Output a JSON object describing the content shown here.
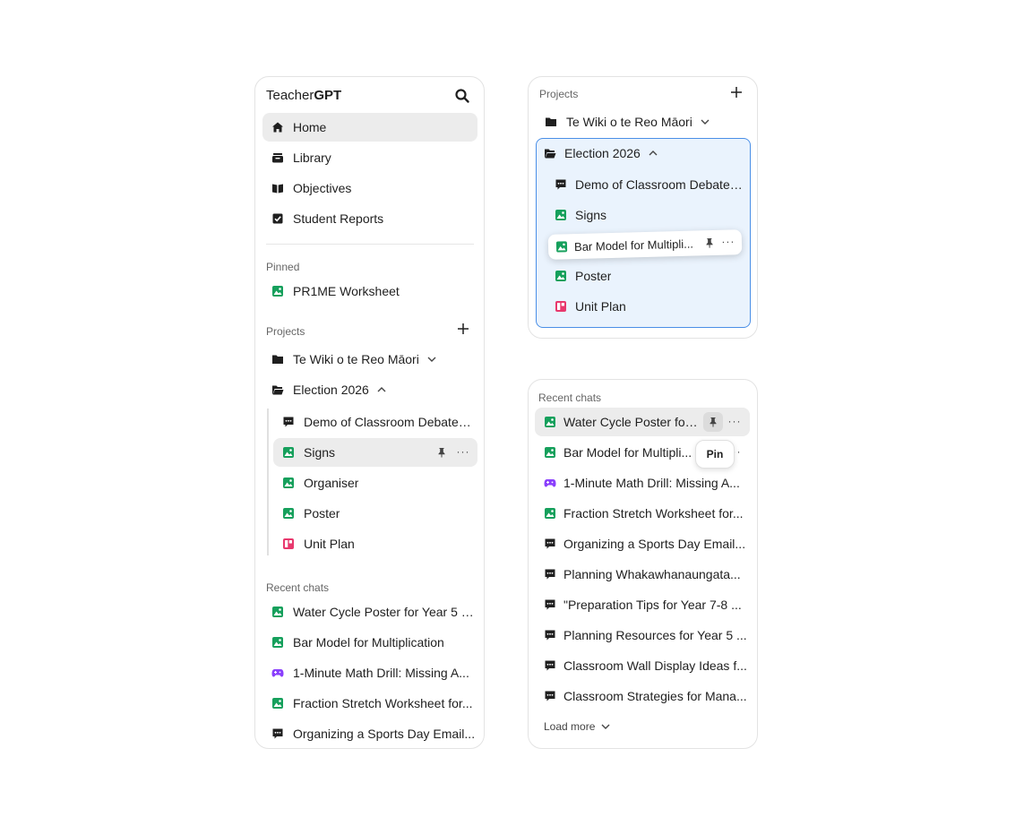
{
  "colors": {
    "image_icon": "#16a05c",
    "chat_icon": "#1f1f1f",
    "game_icon": "#8a3ffc",
    "plan_icon": "#e8386d",
    "highlight_border": "#4a8fe7",
    "highlight_bg": "#eaf3fd"
  },
  "sidebar": {
    "brand_prefix": "Teacher",
    "brand_suffix": "GPT",
    "nav": [
      {
        "label": "Home",
        "icon": "home-icon"
      },
      {
        "label": "Library",
        "icon": "library-icon"
      },
      {
        "label": "Objectives",
        "icon": "book-icon"
      },
      {
        "label": "Student Reports",
        "icon": "checkbox-icon"
      }
    ],
    "pinned_label": "Pinned",
    "pinned": [
      {
        "label": "PR1ME Worksheet",
        "icon": "image-icon"
      }
    ],
    "projects_label": "Projects",
    "projects": [
      {
        "label": "Te Wiki o te Reo Māori",
        "icon": "folder-icon"
      },
      {
        "label": "Election 2026",
        "icon": "folder-open-icon"
      }
    ],
    "election_items": [
      {
        "label": "Demo of Classroom Debate ...",
        "icon": "chat-icon"
      },
      {
        "label": "Signs",
        "icon": "image-icon"
      },
      {
        "label": "Organiser",
        "icon": "image-icon"
      },
      {
        "label": "Poster",
        "icon": "image-icon"
      },
      {
        "label": "Unit Plan",
        "icon": "plan-icon"
      }
    ],
    "recent_label": "Recent chats",
    "recent": [
      {
        "label": "Water Cycle Poster for Year 5 S...",
        "icon": "image-icon"
      },
      {
        "label": "Bar Model for Multiplication",
        "icon": "image-icon"
      },
      {
        "label": "1-Minute Math Drill: Missing A...",
        "icon": "game-icon"
      },
      {
        "label": "Fraction Stretch Worksheet for...",
        "icon": "image-icon"
      },
      {
        "label": "Organizing a Sports Day Email...",
        "icon": "chat-icon"
      }
    ]
  },
  "projects_panel": {
    "title": "Projects",
    "projects": [
      {
        "label": "Te Wiki o te Reo Māori"
      },
      {
        "label": "Election 2026"
      }
    ],
    "items": [
      {
        "label": "Demo of Classroom Debate ...",
        "icon": "chat-icon"
      },
      {
        "label": "Signs",
        "icon": "image-icon"
      },
      {
        "label": "Poster",
        "icon": "image-icon"
      },
      {
        "label": "Unit Plan",
        "icon": "plan-icon"
      }
    ],
    "dragging_item": {
      "label": "Bar Model for Multipli...",
      "icon": "image-icon"
    }
  },
  "recent_panel": {
    "title": "Recent chats",
    "items": [
      {
        "label": "Water Cycle Poster for ...",
        "icon": "image-icon"
      },
      {
        "label": "Bar Model for Multipli...",
        "icon": "image-icon"
      },
      {
        "label": "1-Minute Math Drill: Missing A...",
        "icon": "game-icon"
      },
      {
        "label": "Fraction Stretch Worksheet for...",
        "icon": "image-icon"
      },
      {
        "label": "Organizing a Sports Day Email...",
        "icon": "chat-icon"
      },
      {
        "label": "Planning Whakawhanaungata...",
        "icon": "chat-icon"
      },
      {
        "label": "\"Preparation Tips for Year 7-8 ...",
        "icon": "chat-icon"
      },
      {
        "label": "Planning Resources for Year 5 ...",
        "icon": "chat-icon"
      },
      {
        "label": "Classroom Wall Display Ideas f...",
        "icon": "chat-icon"
      },
      {
        "label": "Classroom Strategies for Mana...",
        "icon": "chat-icon"
      }
    ],
    "tooltip": "Pin",
    "load_more": "Load more"
  }
}
